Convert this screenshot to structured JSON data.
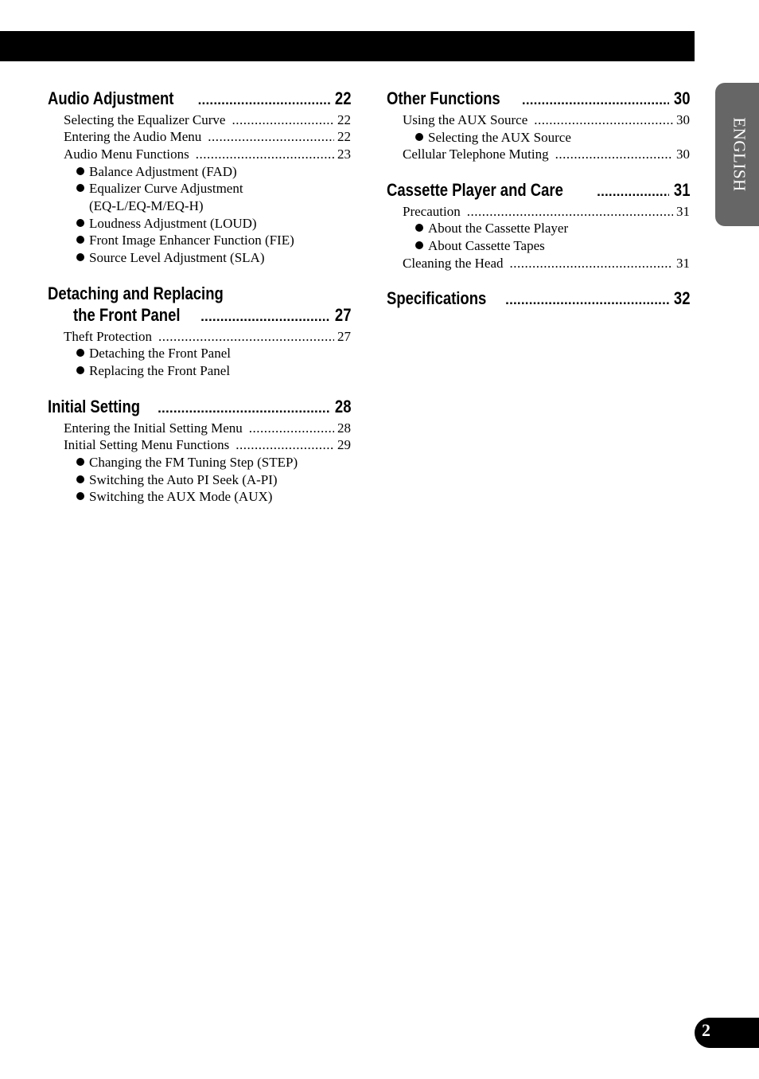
{
  "tab_label": "ENGLISH",
  "page_number": "2",
  "columns": [
    [
      {
        "type": "head",
        "label": "Audio Adjustment",
        "page": "22"
      },
      {
        "type": "entry",
        "label": "Selecting the Equalizer Curve",
        "page": "22"
      },
      {
        "type": "entry",
        "label": "Entering the Audio Menu",
        "page": "22"
      },
      {
        "type": "entry",
        "label": "Audio Menu Functions",
        "page": "23"
      },
      {
        "type": "bullet",
        "label": "Balance Adjustment (FAD)"
      },
      {
        "type": "bullet",
        "label": "Equalizer Curve Adjustment"
      },
      {
        "type": "cont",
        "label": "(EQ-L/EQ-M/EQ-H)"
      },
      {
        "type": "bullet",
        "label": "Loudness Adjustment (LOUD)"
      },
      {
        "type": "bullet",
        "label": "Front Image Enhancer Function (FIE)"
      },
      {
        "type": "bullet",
        "label": "Source Level Adjustment (SLA)"
      },
      {
        "type": "headline",
        "label": "Detaching and Replacing"
      },
      {
        "type": "head2",
        "label": "the Front Panel",
        "page": "27"
      },
      {
        "type": "entry",
        "label": "Theft Protection",
        "page": "27"
      },
      {
        "type": "bullet",
        "label": "Detaching the Front Panel"
      },
      {
        "type": "bullet",
        "label": "Replacing the Front Panel"
      },
      {
        "type": "head",
        "label": "Initial Setting",
        "page": "28"
      },
      {
        "type": "entry",
        "label": "Entering the Initial Setting Menu",
        "page": "28"
      },
      {
        "type": "entry",
        "label": "Initial Setting Menu Functions",
        "page": "29"
      },
      {
        "type": "bullet",
        "label": "Changing the FM Tuning Step (STEP)"
      },
      {
        "type": "bullet",
        "label": "Switching the Auto PI Seek (A-PI)"
      },
      {
        "type": "bullet",
        "label": "Switching the AUX Mode (AUX)"
      }
    ],
    [
      {
        "type": "head",
        "label": "Other Functions",
        "page": "30"
      },
      {
        "type": "entry",
        "label": "Using the AUX Source",
        "page": "30"
      },
      {
        "type": "bullet",
        "label": "Selecting the AUX Source"
      },
      {
        "type": "entry",
        "label": "Cellular Telephone Muting",
        "page": "30"
      },
      {
        "type": "head",
        "label": "Cassette Player and Care",
        "page": "31"
      },
      {
        "type": "entry",
        "label": "Precaution",
        "page": "31"
      },
      {
        "type": "bullet",
        "label": "About the Cassette Player"
      },
      {
        "type": "bullet",
        "label": "About Cassette Tapes"
      },
      {
        "type": "entry",
        "label": "Cleaning the Head",
        "page": "31"
      },
      {
        "type": "head",
        "label": "Specifications",
        "page": "32"
      }
    ]
  ]
}
